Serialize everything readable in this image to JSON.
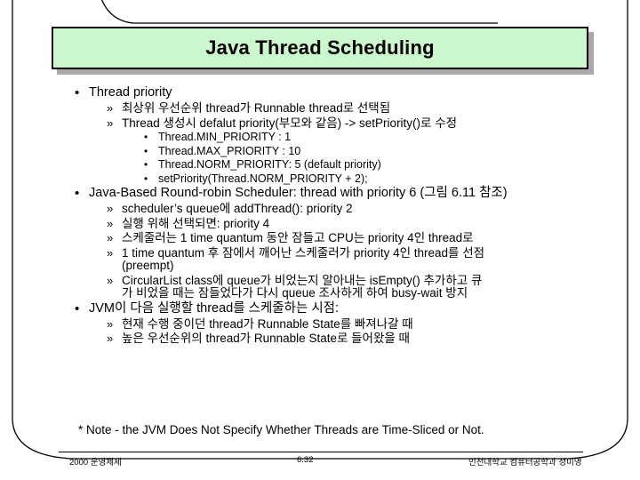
{
  "slide": {
    "title": "Java Thread Scheduling",
    "title_bg_color": "#CCF7CC",
    "title_border_color": "#000000",
    "title_shadow_color": "#A9A9A9"
  },
  "content": [
    {
      "level": 1,
      "bullet": "•",
      "text": "Thread priority"
    },
    {
      "level": 2,
      "bullet": "»",
      "text": "최상위 우선순위 thread가 Runnable thread로 선택됨"
    },
    {
      "level": 2,
      "bullet": "»",
      "text": "Thread 생성시 defalut priority(부모와 같음) -> setPriority()로 수정"
    },
    {
      "level": 3,
      "bullet": "•",
      "text": "Thread.MIN_PRIORITY : 1"
    },
    {
      "level": 3,
      "bullet": "•",
      "text": "Thread.MAX_PRIORITY : 10"
    },
    {
      "level": 3,
      "bullet": "•",
      "text": "Thread.NORM_PRIORITY: 5 (default priority)"
    },
    {
      "level": 3,
      "bullet": "•",
      "text": "setPriority(Thread.NORM_PRIORITY + 2);"
    },
    {
      "level": 1,
      "bullet": "•",
      "text": "Java-Based Round-robin Scheduler: thread with priority 6 (그림 6.11 참조)"
    },
    {
      "level": 2,
      "bullet": "»",
      "text": "scheduler’s queue에 addThread(): priority 2"
    },
    {
      "level": 2,
      "bullet": "»",
      "text": "실행 위해 선택되면: priority 4"
    },
    {
      "level": 2,
      "bullet": "»",
      "text": "스케줄러는 1 time quantum 동안 잠들고 CPU는 priority 4인 thread로"
    },
    {
      "level": 2,
      "bullet": "»",
      "text": "1 time quantum 후 잠에서 깨어난 스케줄러가 priority 4인 thread를 선점"
    },
    {
      "level": 2,
      "bullet": "",
      "continuation": true,
      "text": "(preempt)"
    },
    {
      "level": 2,
      "bullet": "»",
      "text": "CircularList class에 queue가 비었는지 알아내는 isEmpty() 추가하고 큐"
    },
    {
      "level": 2,
      "bullet": "",
      "continuation": true,
      "text": "가 비었을 때는 잠들었다가 다시 queue 조사하게 하여 busy-wait 방지"
    },
    {
      "level": 1,
      "bullet": "•",
      "text": "JVM이 다음 실행할 thread를 스케줄하는 시점:"
    },
    {
      "level": 2,
      "bullet": "»",
      "text": "현재 수행 중이던 thread가 Runnable State를 빠져나갈 때"
    },
    {
      "level": 2,
      "bullet": "»",
      "text": "높은 우선순위의 thread가 Runnable State로 들어왔을 때"
    }
  ],
  "note": "* Note - the JVM Does Not Specify Whether Threads are Time-Sliced or Not.",
  "footer": {
    "left": "2000 운영체제",
    "page": "6.32",
    "right": "인천대학교 컴퓨터공학과 성미영"
  }
}
